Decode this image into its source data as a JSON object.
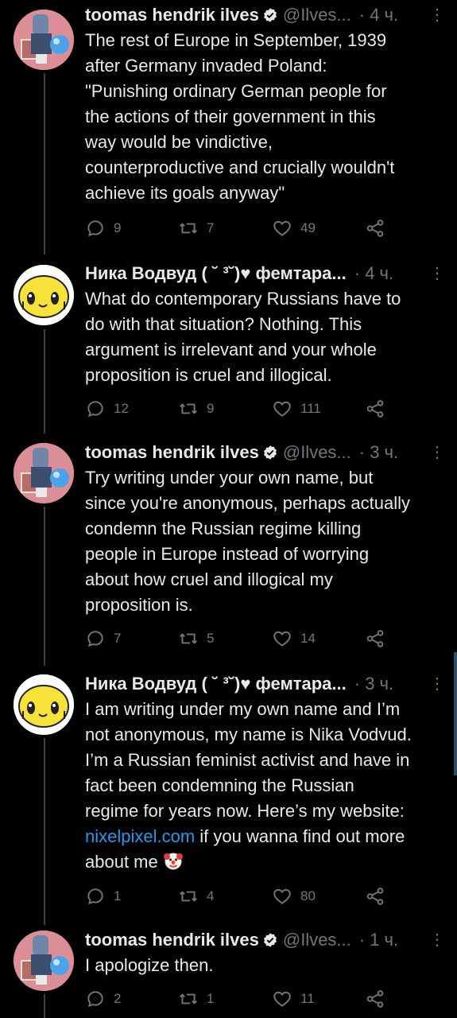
{
  "tweets": [
    {
      "author": "toomas hendrik ilves",
      "handle": "@Ilves...",
      "time": "· 4 ч.",
      "verified": true,
      "avatar": "ilves",
      "text": "The rest of Europe in September, 1939\nafter Germany invaded Poland:\n\"Punishing ordinary German people for\nthe actions of their government in this\nway would be vindictive,\ncounterproductive and crucially wouldn't\nachieve its goals anyway\"",
      "replies": "9",
      "retweets": "7",
      "likes": "49"
    },
    {
      "author": "Ника Водвуд ( ˘ ³˘)♥ фемтара...",
      "handle": "",
      "time": "· 4 ч.",
      "verified": false,
      "avatar": "nika",
      "text": "What do contemporary Russians have to\ndo with that situation? Nothing. This\nargument is irrelevant and your whole\nproposition is cruel and illogical.",
      "replies": "12",
      "retweets": "9",
      "likes": "111"
    },
    {
      "author": "toomas hendrik ilves",
      "handle": "@Ilves...",
      "time": "· 3 ч.",
      "verified": true,
      "avatar": "ilves",
      "text": "Try writing under your own name, but\nsince you're anonymous, perhaps actually\ncondemn the Russian regime killing\npeople in Europe instead of worrying\nabout how cruel and illogical my\nproposition is.",
      "replies": "7",
      "retweets": "5",
      "likes": "14"
    },
    {
      "author": "Ника Водвуд ( ˘ ³˘)♥ фемтара...",
      "handle": "",
      "time": "· 3 ч.",
      "verified": false,
      "avatar": "nika",
      "text_before": "I am writing under my own name and I’m\nnot anonymous, my name is Nika Vodvud.\nI’m a Russian feminist activist and have in\nfact been condemning the Russian\nregime for years now. Here’s my website:\n",
      "link": "nixelpixel.com",
      "text_after": " if you wanna find out more\nabout me ",
      "emoji": "clown-face-icon",
      "replies": "1",
      "retweets": "4",
      "likes": "80"
    },
    {
      "author": "toomas hendrik ilves",
      "handle": "@Ilves...",
      "time": "· 1 ч.",
      "verified": true,
      "avatar": "ilves",
      "text": "I apologize then.",
      "replies": "2",
      "retweets": "1",
      "likes": "11"
    }
  ],
  "more_glyph": "⋮",
  "colors": {
    "background": "#000000",
    "text": "#e7e9ea",
    "muted": "#71767b",
    "link": "#1d9bf0",
    "verified": "#e7e9ea"
  }
}
